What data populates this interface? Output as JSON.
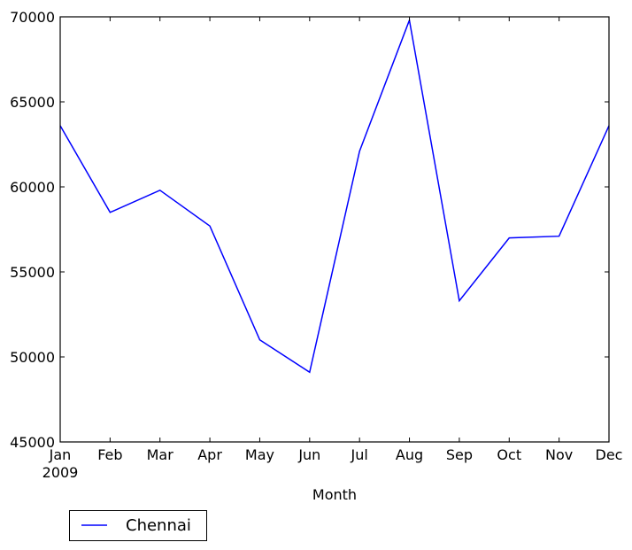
{
  "chart_data": {
    "type": "line",
    "title": "",
    "xlabel": "Month",
    "ylabel": "",
    "categories": [
      "Jan",
      "Feb",
      "Mar",
      "Apr",
      "May",
      "Jun",
      "Jul",
      "Aug",
      "Sep",
      "Oct",
      "Nov",
      "Dec"
    ],
    "x_sublabel": "2009",
    "ylim": [
      45000,
      70000
    ],
    "yticks": [
      45000,
      50000,
      55000,
      60000,
      65000,
      70000
    ],
    "ytick_labels": [
      "45000",
      "50000",
      "55000",
      "60000",
      "65000",
      "70000"
    ],
    "grid": false,
    "legend_placement": "below-left",
    "series": [
      {
        "name": "Chennai",
        "color": "#0000ff",
        "values": [
          63600,
          58500,
          59800,
          57700,
          51000,
          49100,
          62100,
          69800,
          53300,
          57000,
          57100,
          63600
        ]
      }
    ]
  }
}
